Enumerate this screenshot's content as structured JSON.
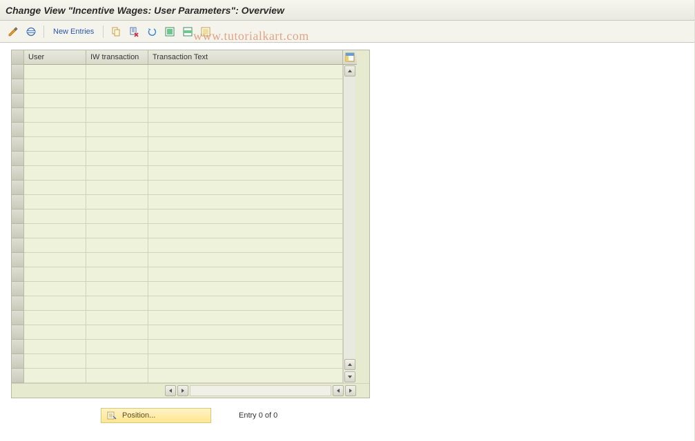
{
  "header": {
    "title": "Change View \"Incentive Wages: User Parameters\": Overview"
  },
  "toolbar": {
    "new_entries_label": "New Entries",
    "icons": {
      "toggle": "toggle-display-change-icon",
      "other": "other-view-icon",
      "copy": "copy-icon",
      "delete": "delete-icon",
      "undo": "undo-icon",
      "select_all": "select-all-icon",
      "select_block": "select-block-icon",
      "deselect": "deselect-all-icon"
    }
  },
  "watermark": "www.tutorialkart.com",
  "grid": {
    "columns": [
      {
        "key": "user",
        "label": "User"
      },
      {
        "key": "iw",
        "label": "IW transaction"
      },
      {
        "key": "txt",
        "label": "Transaction Text"
      }
    ],
    "config_tool": "table-settings",
    "row_count": 22
  },
  "footer": {
    "position_label": "Position...",
    "entry_text": "Entry 0 of 0"
  }
}
